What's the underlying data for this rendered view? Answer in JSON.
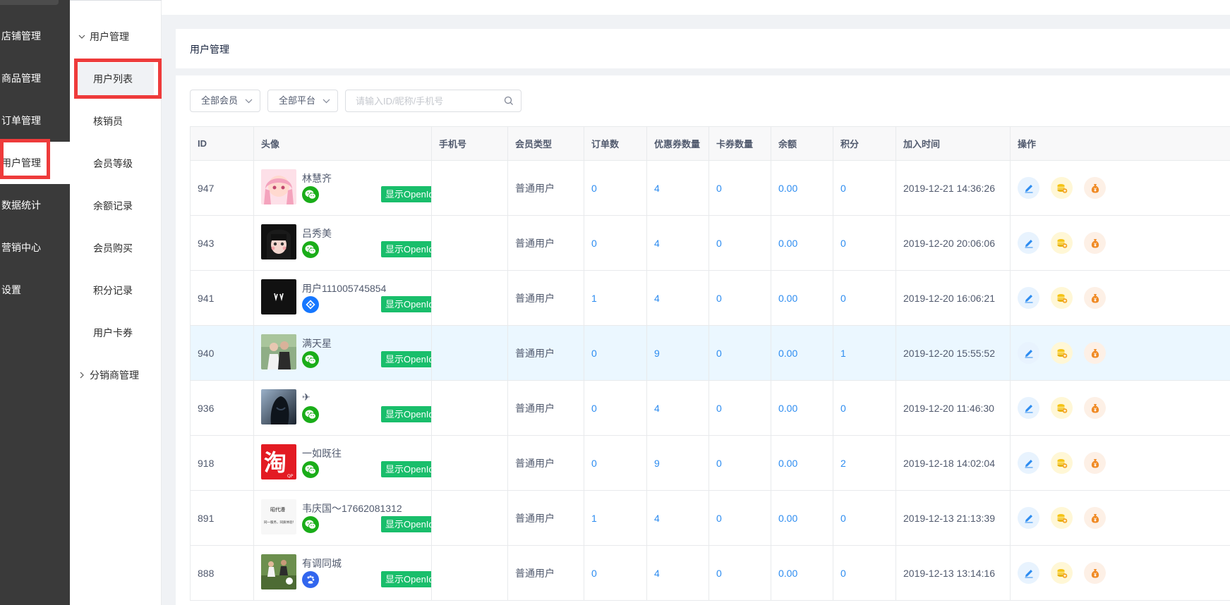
{
  "main_nav": [
    {
      "label": "店铺管理",
      "active": false
    },
    {
      "label": "商品管理",
      "active": false
    },
    {
      "label": "订单管理",
      "active": false
    },
    {
      "label": "用户管理",
      "active": true
    },
    {
      "label": "数据统计",
      "active": false
    },
    {
      "label": "营销中心",
      "active": false
    },
    {
      "label": "设置",
      "active": false
    }
  ],
  "sub_nav": {
    "group_label": "用户管理",
    "items": [
      {
        "label": "用户列表",
        "active": true
      },
      {
        "label": "核销员",
        "active": false
      },
      {
        "label": "会员等级",
        "active": false
      },
      {
        "label": "余额记录",
        "active": false
      },
      {
        "label": "会员购买",
        "active": false
      },
      {
        "label": "积分记录",
        "active": false
      },
      {
        "label": "用户卡券",
        "active": false
      }
    ],
    "group2_label": "分销商管理"
  },
  "page_title": "用户管理",
  "filters": {
    "member": "全部会员",
    "platform": "全部平台",
    "search_placeholder": "请输入ID/昵称/手机号"
  },
  "table": {
    "headers": [
      "ID",
      "头像",
      "手机号",
      "会员类型",
      "订单数",
      "优惠券数量",
      "卡券数量",
      "余额",
      "积分",
      "加入时间",
      "操作"
    ],
    "openid_label": "显示OpenId",
    "rows": [
      {
        "id": "947",
        "nick": "林慧齐",
        "platform": "wechat",
        "phone": "",
        "type": "普通用户",
        "orders": "0",
        "coupons": "4",
        "cards": "0",
        "balance": "0.00",
        "points": "0",
        "joined": "2019-12-21 14:36:26",
        "avatar": "anime"
      },
      {
        "id": "943",
        "nick": "吕秀美",
        "platform": "wechat",
        "phone": "",
        "type": "普通用户",
        "orders": "0",
        "coupons": "4",
        "cards": "0",
        "balance": "0.00",
        "points": "0",
        "joined": "2019-12-20 20:06:06",
        "avatar": "girl"
      },
      {
        "id": "941",
        "nick": "用户111005745854",
        "platform": "alipay",
        "phone": "",
        "type": "普通用户",
        "orders": "1",
        "coupons": "4",
        "cards": "0",
        "balance": "0.00",
        "points": "0",
        "joined": "2019-12-20 16:06:21",
        "avatar": "dark"
      },
      {
        "id": "940",
        "nick": "满天星",
        "platform": "wechat",
        "phone": "",
        "type": "普通用户",
        "orders": "0",
        "coupons": "9",
        "cards": "0",
        "balance": "0.00",
        "points": "1",
        "joined": "2019-12-20 15:55:52",
        "avatar": "couple"
      },
      {
        "id": "936",
        "nick": "✈",
        "platform": "wechat",
        "phone": "",
        "type": "普通用户",
        "orders": "0",
        "coupons": "4",
        "cards": "0",
        "balance": "0.00",
        "points": "0",
        "joined": "2019-12-20 11:46:30",
        "avatar": "hero"
      },
      {
        "id": "918",
        "nick": "一如既往",
        "platform": "wechat",
        "phone": "",
        "type": "普通用户",
        "orders": "0",
        "coupons": "9",
        "cards": "0",
        "balance": "0.00",
        "points": "2",
        "joined": "2019-12-18 14:02:04",
        "avatar": "taobao"
      },
      {
        "id": "891",
        "nick": "韦庆国～17662081312",
        "platform": "wechat",
        "phone": "",
        "type": "普通用户",
        "orders": "1",
        "coupons": "4",
        "cards": "0",
        "balance": "0.00",
        "points": "0",
        "joined": "2019-12-13 21:13:39",
        "avatar": "text"
      },
      {
        "id": "888",
        "nick": "有调同城",
        "platform": "baidu",
        "phone": "",
        "type": "普通用户",
        "orders": "0",
        "coupons": "4",
        "cards": "0",
        "balance": "0.00",
        "points": "0",
        "joined": "2019-12-13 13:14:16",
        "avatar": "sports"
      }
    ]
  },
  "colors": {
    "sidebar_bg": "#3a3a3a",
    "highlight": "#ee3b3b",
    "link": "#2d8cf0",
    "openid_green": "#19be6b"
  }
}
